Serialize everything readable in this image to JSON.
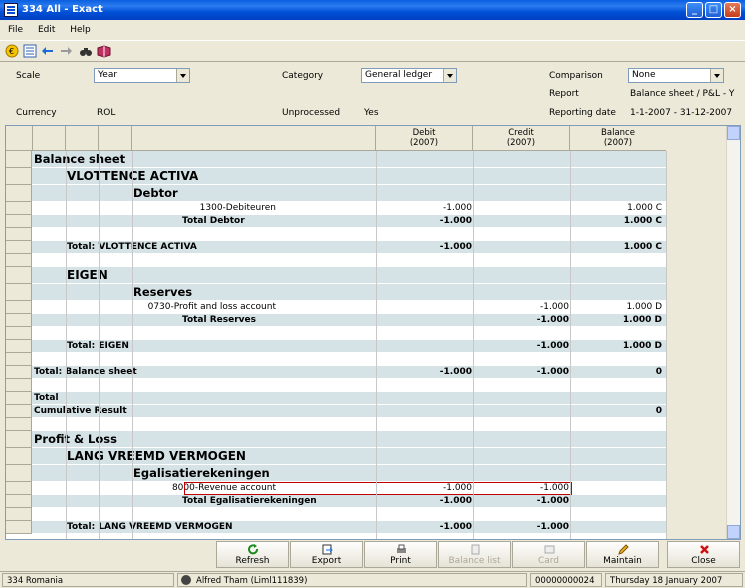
{
  "window": {
    "title": "334 All - Exact"
  },
  "menu": {
    "file": "File",
    "edit": "Edit",
    "help": "Help"
  },
  "filters": {
    "scale_label": "Scale",
    "scale_value": "Year",
    "category_label": "Category",
    "category_value": "General ledger",
    "comparison_label": "Comparison",
    "comparison_value": "None",
    "report_label": "Report",
    "report_value": "Balance sheet / P&L - Y",
    "currency_label": "Currency",
    "currency_value": "ROL",
    "unprocessed_label": "Unprocessed",
    "unprocessed_value": "Yes",
    "reporting_date_label": "Reporting date",
    "reporting_date_value": "1-1-2007 - 31-12-2007"
  },
  "columns": {
    "debit": "Debit",
    "debit_year": "(2007)",
    "credit": "Credit",
    "credit_year": "(2007)",
    "balance": "Balance",
    "balance_year": "(2007)"
  },
  "rows": [
    {
      "c0": "Balance sheet",
      "style": "h1",
      "shade": true
    },
    {
      "c1": "VLOTTENCE ACTIVA",
      "style": "h2",
      "shade": true
    },
    {
      "c2": "Debtor",
      "style": "h1",
      "shade": true
    },
    {
      "c3": "1300-Debiteuren",
      "debit": "-1.000",
      "credit": "",
      "balance": "1.000 C",
      "shade": false
    },
    {
      "c3": "Total Debtor",
      "debit": "-1.000",
      "credit": "",
      "balance": "1.000 C",
      "style": "bold",
      "shade": true
    },
    {
      "shade": false
    },
    {
      "c1": "Total: VLOTTENCE ACTIVA",
      "debit": "-1.000",
      "credit": "",
      "balance": "1.000 C",
      "style": "bold",
      "shade": true
    },
    {
      "shade": false
    },
    {
      "c1": "EIGEN",
      "style": "h2",
      "shade": true
    },
    {
      "c2": "Reserves",
      "style": "h1",
      "shade": true
    },
    {
      "c3": "0730-Profit and loss account",
      "debit": "",
      "credit": "-1.000",
      "balance": "1.000 D",
      "shade": false
    },
    {
      "c3": "Total Reserves",
      "debit": "",
      "credit": "-1.000",
      "balance": "1.000 D",
      "style": "bold",
      "shade": true
    },
    {
      "shade": false
    },
    {
      "c1": "Total: EIGEN",
      "debit": "",
      "credit": "-1.000",
      "balance": "1.000 D",
      "style": "bold",
      "shade": true
    },
    {
      "shade": false
    },
    {
      "c0": "Total: Balance sheet",
      "debit": "-1.000",
      "credit": "-1.000",
      "balance": "0",
      "style": "bold",
      "shade": true
    },
    {
      "shade": false
    },
    {
      "c0": "Total",
      "style": "bold",
      "shade": true
    },
    {
      "c0": "Cumulative Result",
      "debit": "",
      "credit": "",
      "balance": "0",
      "style": "bold",
      "shade": true
    },
    {
      "shade": false
    },
    {
      "c0": "Profit & Loss",
      "style": "h1",
      "shade": true
    },
    {
      "c1": "LANG VREEMD VERMOGEN",
      "style": "h2",
      "shade": true
    },
    {
      "c2": "Egalisatierekeningen",
      "style": "h1",
      "shade": true
    },
    {
      "c3": "8000-Revenue account",
      "debit": "-1.000",
      "credit": "-1.000",
      "balance": "",
      "shade": false,
      "selected": true
    },
    {
      "c3": "Total Egalisatierekeningen",
      "debit": "-1.000",
      "credit": "-1.000",
      "balance": "",
      "style": "bold",
      "shade": true
    },
    {
      "shade": false
    },
    {
      "c1": "Total: LANG VREEMD VERMOGEN",
      "debit": "-1.000",
      "credit": "-1.000",
      "balance": "",
      "style": "bold",
      "shade": true
    }
  ],
  "buttons": {
    "refresh": "Refresh",
    "export": "Export",
    "print": "Print",
    "balance_list": "Balance list",
    "card": "Card",
    "maintain": "Maintain",
    "close": "Close"
  },
  "status": {
    "company": "334 Romania",
    "user": "Alfred Tham (Liml111839)",
    "number": "00000000024",
    "date": "Thursday 18 January 2007"
  }
}
